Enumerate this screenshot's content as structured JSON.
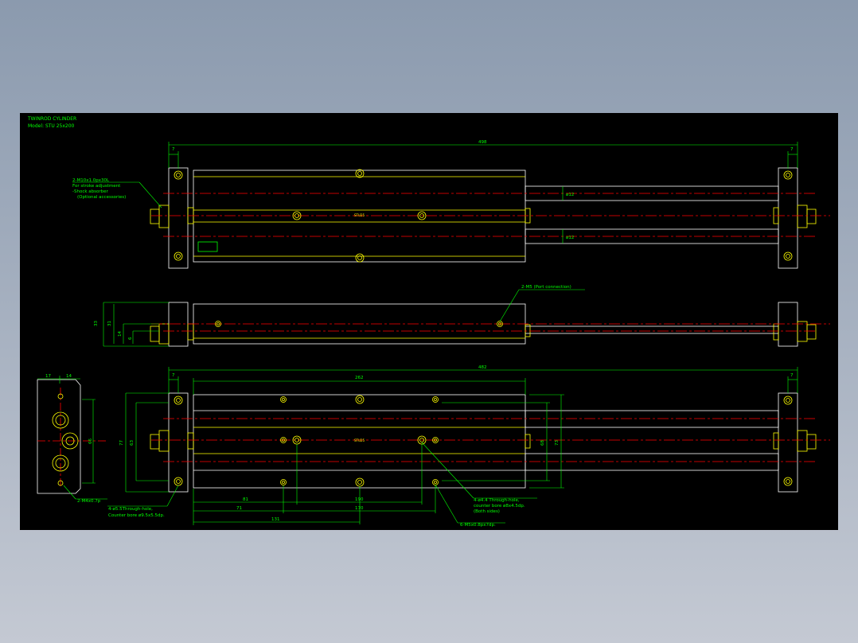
{
  "title_block": {
    "line1": "TWINROD CYLINDER",
    "line2": "Model: STU 25x200"
  },
  "labels": {
    "center_mark": "STU25",
    "note_stopper_1": "2-M10x1.0px30L",
    "note_stopper_2": "For stroke adjustment",
    "note_stopper_3": "-Shock absorber",
    "note_stopper_4": "(Optional accessories)",
    "note_port": "2-M5 (Port connection)",
    "note_side_tap": "2-M4x0.7p",
    "note_through1_1": "4-ø5.5Through-hole,",
    "note_through1_2": "Counter bore ø9.5x5.5dp.",
    "note_through2_1": "4-ø4.4 Through-hole,",
    "note_through2_2": "counter bore ø8x4.5dp.",
    "note_through2_3": "(Both sides)",
    "note_tap_m5": "6-M5x0.8px7dp."
  },
  "dims": {
    "top_overall": "498",
    "top_left": "7",
    "top_right": "7",
    "rod_dia_1": "ø12",
    "rod_dia_2": "ø12",
    "side_h1": "33",
    "side_h2": "31",
    "side_h3": "14",
    "side_h4": "6",
    "end_w1": "17",
    "end_w2": "14",
    "end_h": "66",
    "bot_overall": "482",
    "bot_left": "7",
    "bot_right": "7",
    "body_len": "262",
    "h_77": "77",
    "h_63": "63",
    "h_68": "68",
    "h_73": "73",
    "d_81": "81",
    "d_190": "190",
    "d_71": "71",
    "d_170": "170",
    "d_131": "131"
  }
}
